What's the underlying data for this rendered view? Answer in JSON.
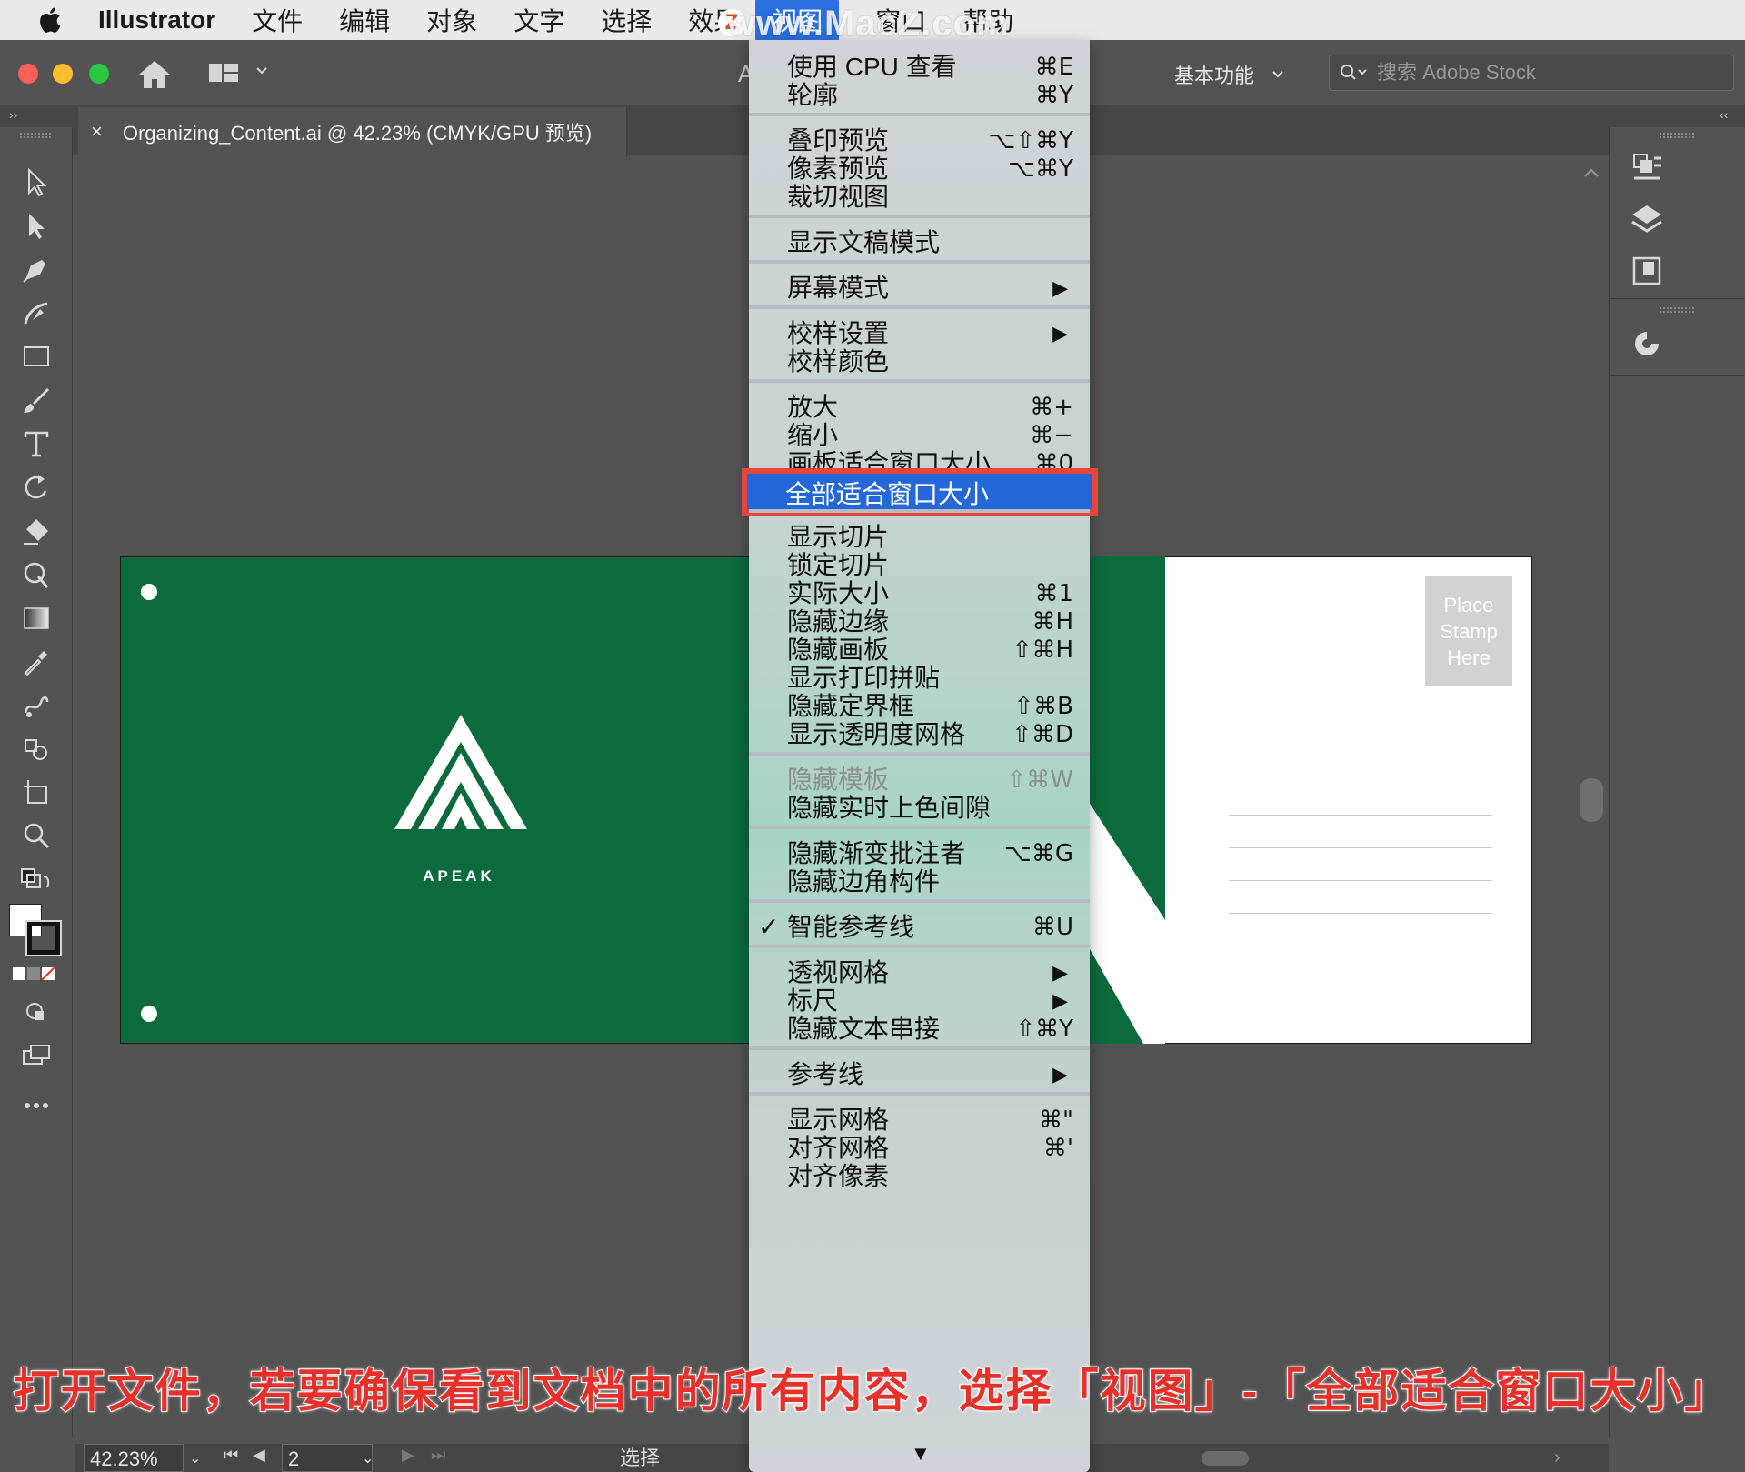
{
  "menubar": {
    "app_name": "Illustrator",
    "items": [
      "文件",
      "编辑",
      "对象",
      "文字",
      "选择",
      "效果",
      "视图",
      "窗口",
      "帮助"
    ],
    "active_item": "视图"
  },
  "watermark": {
    "text": "www.MacZ.com",
    "badge": "Z"
  },
  "appbar": {
    "title_fragment": "A",
    "workspace": "基本功能",
    "search_placeholder": "搜索 Adobe Stock"
  },
  "document_tab": {
    "close": "×",
    "title": "Organizing_Content.ai @ 42.23% (CMYK/GPU 预览)"
  },
  "panel_collapse": {
    "left": "››",
    "right": "‹‹"
  },
  "artboard": {
    "brand": "APEAK",
    "stamp": [
      "Place",
      "Stamp",
      "Here"
    ],
    "colors": {
      "green": "#0c6b3d",
      "white": "#ffffff",
      "stamp": "#d2d2d2"
    }
  },
  "view_menu": {
    "sections": [
      [
        {
          "label": "使用 CPU 查看",
          "shortcut": "⌘E"
        },
        {
          "label": "轮廓",
          "shortcut": "⌘Y"
        }
      ],
      [
        {
          "label": "叠印预览",
          "shortcut": "⌥⇧⌘Y"
        },
        {
          "label": "像素预览",
          "shortcut": "⌥⌘Y"
        },
        {
          "label": "裁切视图",
          "shortcut": ""
        }
      ],
      [
        {
          "label": "显示文稿模式",
          "shortcut": ""
        }
      ],
      [
        {
          "label": "屏幕模式",
          "shortcut": "",
          "submenu": true
        }
      ],
      [
        {
          "label": "校样设置",
          "shortcut": "",
          "submenu": true
        },
        {
          "label": "校样颜色",
          "shortcut": ""
        }
      ],
      [
        {
          "label": "放大",
          "shortcut": "⌘+"
        },
        {
          "label": "缩小",
          "shortcut": "⌘−"
        },
        {
          "label": "画板适合窗口大小",
          "shortcut": "⌘0"
        },
        {
          "label": "全部适合窗口大小",
          "shortcut": "",
          "selected": true
        }
      ],
      [
        {
          "label": "显示切片",
          "shortcut": ""
        },
        {
          "label": "锁定切片",
          "shortcut": ""
        },
        {
          "label": "实际大小",
          "shortcut": "⌘1"
        },
        {
          "label": "隐藏边缘",
          "shortcut": "⌘H"
        },
        {
          "label": "隐藏画板",
          "shortcut": "⇧⌘H"
        },
        {
          "label": "显示打印拼贴",
          "shortcut": ""
        },
        {
          "label": "隐藏定界框",
          "shortcut": "⇧⌘B"
        },
        {
          "label": "显示透明度网格",
          "shortcut": "⇧⌘D"
        }
      ],
      [
        {
          "label": "隐藏模板",
          "shortcut": "⇧⌘W",
          "disabled": true
        },
        {
          "label": "隐藏实时上色间隙",
          "shortcut": ""
        }
      ],
      [
        {
          "label": "隐藏渐变批注者",
          "shortcut": "⌥⌘G"
        },
        {
          "label": "隐藏边角构件",
          "shortcut": ""
        }
      ],
      [
        {
          "label": "智能参考线",
          "shortcut": "⌘U",
          "checked": true
        }
      ],
      [
        {
          "label": "透视网格",
          "shortcut": "",
          "submenu": true
        },
        {
          "label": "标尺",
          "shortcut": "",
          "submenu": true
        },
        {
          "label": "隐藏文本串接",
          "shortcut": "⇧⌘Y"
        }
      ],
      [
        {
          "label": "参考线",
          "shortcut": "",
          "submenu": true
        }
      ],
      [
        {
          "label": "显示网格",
          "shortcut": "⌘\""
        },
        {
          "label": "对齐网格",
          "shortcut": "⌘'"
        },
        {
          "label": "对齐像素",
          "shortcut": ""
        }
      ]
    ],
    "check_glyph": "✓",
    "submenu_glyph": "▶",
    "more_glyph": "▼"
  },
  "statusbar": {
    "zoom": "42.23%",
    "page": "2",
    "mode": "选择"
  },
  "caption": "打开文件，若要确保看到文档中的所有内容，选择「视图」-「全部适合窗口大小」"
}
